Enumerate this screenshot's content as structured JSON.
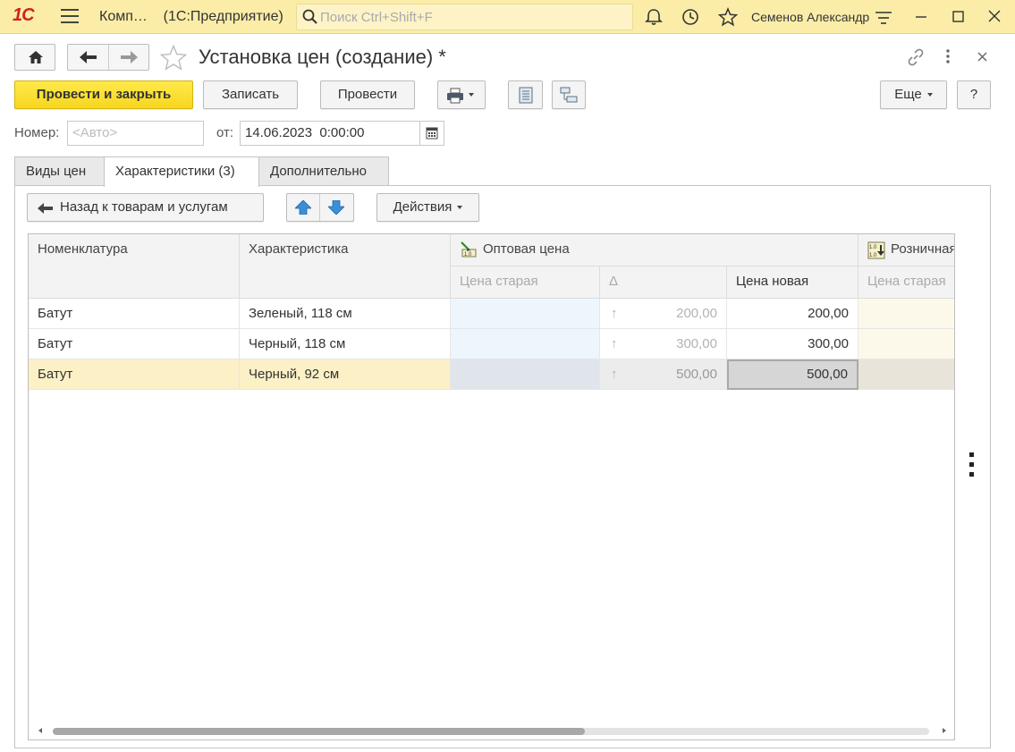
{
  "titlebar": {
    "logo": "1С",
    "app_name": "Комп…",
    "app_platform": "(1С:Предприятие)",
    "search_placeholder": "Поиск Ctrl+Shift+F",
    "user": "Семенов Александр"
  },
  "header": {
    "title": "Установка цен (создание) *"
  },
  "toolbar": {
    "post_and_close": "Провести и закрыть",
    "save": "Записать",
    "post": "Провести",
    "more": "Еще",
    "help": "?"
  },
  "form": {
    "number_label": "Номер:",
    "number_placeholder": "<Авто>",
    "date_label": "от:",
    "date_value": "14.06.2023  0:00:00"
  },
  "tabs": [
    {
      "label": "Виды цен"
    },
    {
      "label": "Характеристики (3)"
    },
    {
      "label": "Дополнительно"
    }
  ],
  "panel_toolbar": {
    "back": "Назад к товарам и услугам",
    "actions": "Действия"
  },
  "grid": {
    "headers": {
      "nomenclature": "Номенклатура",
      "characteristic": "Характеристика",
      "wholesale_group": "Оптовая цена",
      "retail_group": "Розничная",
      "old_price": "Цена старая",
      "delta": "Δ",
      "new_price": "Цена новая",
      "old_price_retail": "Цена старая"
    },
    "rows": [
      {
        "item": "Батут",
        "characteristic": "Зеленый, 118 см",
        "delta": "200,00",
        "new_price": "200,00"
      },
      {
        "item": "Батут",
        "characteristic": "Черный, 118 см",
        "delta": "300,00",
        "new_price": "300,00"
      },
      {
        "item": "Батут",
        "characteristic": "Черный, 92 см",
        "delta": "500,00",
        "new_price": "500,00"
      }
    ]
  },
  "colors": {
    "titlebar_bg": "#fbeda8",
    "primary_button": "#f7d620",
    "selected_row": "#fbf0c6",
    "old_price_cell": "#eef6fd",
    "retail_cell": "#fdf9ea"
  }
}
